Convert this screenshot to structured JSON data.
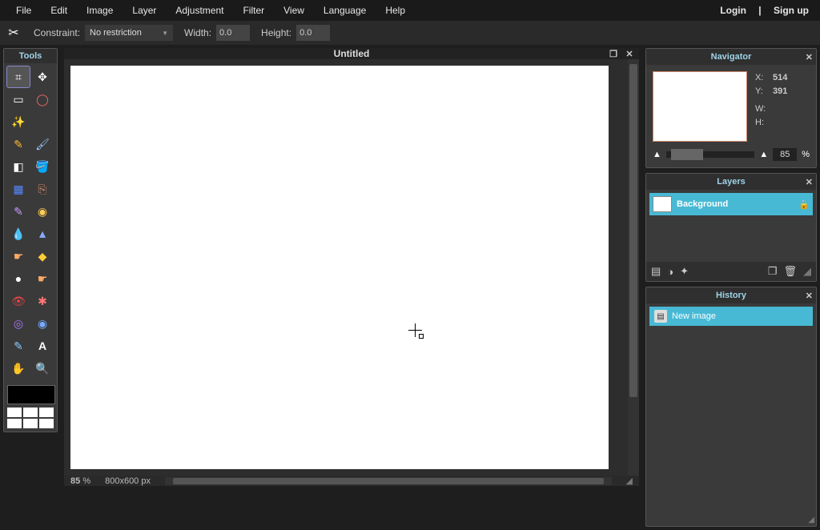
{
  "menu": {
    "file": "File",
    "edit": "Edit",
    "image": "Image",
    "layer": "Layer",
    "adjustment": "Adjustment",
    "filter": "Filter",
    "view": "View",
    "language": "Language",
    "help": "Help"
  },
  "auth": {
    "login": "Login",
    "sep": "|",
    "signup": "Sign up"
  },
  "optbar": {
    "constraint_label": "Constraint:",
    "constraint_value": "No restriction",
    "width_label": "Width:",
    "width_value": "0.0",
    "height_label": "Height:",
    "height_value": "0.0"
  },
  "tools": {
    "title": "Tools"
  },
  "canvas": {
    "title": "Untitled",
    "zoom": "85",
    "zoom_unit": "%",
    "dims": "800x600 px"
  },
  "navigator": {
    "title": "Navigator",
    "x_label": "X:",
    "x": "514",
    "y_label": "Y:",
    "y": "391",
    "w_label": "W:",
    "w": "",
    "h_label": "H:",
    "h": "",
    "zoom": "85",
    "zoom_unit": "%"
  },
  "layers": {
    "title": "Layers",
    "items": [
      {
        "label": "Background"
      }
    ]
  },
  "history": {
    "title": "History",
    "items": [
      {
        "label": "New image"
      }
    ]
  }
}
